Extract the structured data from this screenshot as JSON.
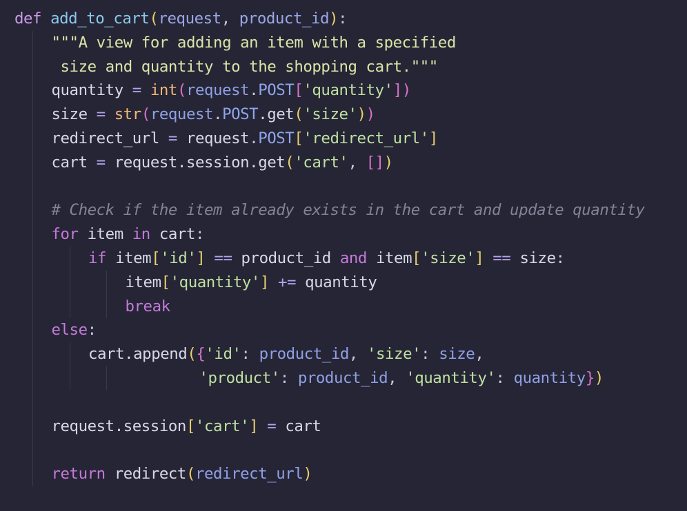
{
  "editor": {
    "language": "python",
    "theme": {
      "background": "#262535",
      "keyword": "#c99be8",
      "function": "#89c8ef",
      "string": "#bfe0a2",
      "comment": "#838398",
      "builtin": "#f0b877"
    },
    "lines": [
      {
        "indent": 0,
        "tokens": [
          {
            "t": "def",
            "c": "kw-def"
          },
          {
            "t": " ",
            "c": "var"
          },
          {
            "t": "add_to_cart",
            "c": "fn-name"
          },
          {
            "t": "(",
            "c": "paren"
          },
          {
            "t": "request",
            "c": "param"
          },
          {
            "t": ", ",
            "c": "punct"
          },
          {
            "t": "product_id",
            "c": "param"
          },
          {
            "t": ")",
            "c": "paren"
          },
          {
            "t": ":",
            "c": "punct"
          }
        ]
      },
      {
        "indent": 1,
        "tokens": [
          {
            "t": "\"\"\"A view for adding an item with a specified",
            "c": "docstr"
          }
        ]
      },
      {
        "indent": 1,
        "tokens": [
          {
            "t": " size and quantity to the shopping cart.\"\"\"",
            "c": "docstr"
          }
        ]
      },
      {
        "indent": 1,
        "tokens": [
          {
            "t": "quantity",
            "c": "var"
          },
          {
            "t": " = ",
            "c": "op"
          },
          {
            "t": "int",
            "c": "builtin"
          },
          {
            "t": "(",
            "c": "bracket"
          },
          {
            "t": "request",
            "c": "ident-param"
          },
          {
            "t": ".",
            "c": "punct"
          },
          {
            "t": "POST",
            "c": "attr"
          },
          {
            "t": "[",
            "c": "bracket"
          },
          {
            "t": "'quantity'",
            "c": "str"
          },
          {
            "t": "]",
            "c": "bracket"
          },
          {
            "t": ")",
            "c": "bracket"
          }
        ]
      },
      {
        "indent": 1,
        "tokens": [
          {
            "t": "size",
            "c": "var"
          },
          {
            "t": " = ",
            "c": "op"
          },
          {
            "t": "str",
            "c": "builtin"
          },
          {
            "t": "(",
            "c": "bracket"
          },
          {
            "t": "request",
            "c": "ident-param"
          },
          {
            "t": ".",
            "c": "punct"
          },
          {
            "t": "POST",
            "c": "attr"
          },
          {
            "t": ".get",
            "c": "var"
          },
          {
            "t": "(",
            "c": "paren"
          },
          {
            "t": "'size'",
            "c": "str"
          },
          {
            "t": ")",
            "c": "paren"
          },
          {
            "t": ")",
            "c": "bracket"
          }
        ]
      },
      {
        "indent": 1,
        "tokens": [
          {
            "t": "redirect_url",
            "c": "var"
          },
          {
            "t": " = ",
            "c": "op"
          },
          {
            "t": "request",
            "c": "var"
          },
          {
            "t": ".",
            "c": "punct"
          },
          {
            "t": "POST",
            "c": "attr"
          },
          {
            "t": "[",
            "c": "paren"
          },
          {
            "t": "'redirect_url'",
            "c": "str"
          },
          {
            "t": "]",
            "c": "paren"
          }
        ]
      },
      {
        "indent": 1,
        "tokens": [
          {
            "t": "cart",
            "c": "var"
          },
          {
            "t": " = ",
            "c": "op"
          },
          {
            "t": "request.session.get",
            "c": "var"
          },
          {
            "t": "(",
            "c": "paren"
          },
          {
            "t": "'cart'",
            "c": "str"
          },
          {
            "t": ", ",
            "c": "punct"
          },
          {
            "t": "[]",
            "c": "bracket"
          },
          {
            "t": ")",
            "c": "paren"
          }
        ]
      },
      {
        "indent": 1,
        "tokens": []
      },
      {
        "indent": 1,
        "tokens": [
          {
            "t": "# Check if the item already exists in the cart and update quantity",
            "c": "comment"
          }
        ]
      },
      {
        "indent": 1,
        "tokens": [
          {
            "t": "for",
            "c": "kw-ctrl"
          },
          {
            "t": " item ",
            "c": "var"
          },
          {
            "t": "in",
            "c": "kw-ctrl"
          },
          {
            "t": " cart",
            "c": "var"
          },
          {
            "t": ":",
            "c": "punct"
          }
        ]
      },
      {
        "indent": 2,
        "tokens": [
          {
            "t": "if",
            "c": "kw-ctrl"
          },
          {
            "t": " item",
            "c": "var"
          },
          {
            "t": "[",
            "c": "paren"
          },
          {
            "t": "'id'",
            "c": "str"
          },
          {
            "t": "]",
            "c": "paren"
          },
          {
            "t": " == ",
            "c": "op"
          },
          {
            "t": "product_id ",
            "c": "var"
          },
          {
            "t": "and",
            "c": "kw-ctrl"
          },
          {
            "t": " item",
            "c": "var"
          },
          {
            "t": "[",
            "c": "paren"
          },
          {
            "t": "'size'",
            "c": "str"
          },
          {
            "t": "]",
            "c": "paren"
          },
          {
            "t": " == ",
            "c": "op"
          },
          {
            "t": "size",
            "c": "var"
          },
          {
            "t": ":",
            "c": "punct"
          }
        ]
      },
      {
        "indent": 3,
        "tokens": [
          {
            "t": "item",
            "c": "var"
          },
          {
            "t": "[",
            "c": "paren"
          },
          {
            "t": "'quantity'",
            "c": "str"
          },
          {
            "t": "]",
            "c": "paren"
          },
          {
            "t": " += ",
            "c": "op"
          },
          {
            "t": "quantity",
            "c": "var"
          }
        ]
      },
      {
        "indent": 3,
        "tokens": [
          {
            "t": "break",
            "c": "kw-ctrl"
          }
        ]
      },
      {
        "indent": 1,
        "tokens": [
          {
            "t": "else",
            "c": "kw-ctrl"
          },
          {
            "t": ":",
            "c": "punct"
          }
        ]
      },
      {
        "indent": 2,
        "tokens": [
          {
            "t": "cart.append",
            "c": "var"
          },
          {
            "t": "(",
            "c": "paren"
          },
          {
            "t": "{",
            "c": "bracket"
          },
          {
            "t": "'id'",
            "c": "str"
          },
          {
            "t": ": ",
            "c": "punct"
          },
          {
            "t": "product_id",
            "c": "ident-param"
          },
          {
            "t": ", ",
            "c": "punct"
          },
          {
            "t": "'size'",
            "c": "str"
          },
          {
            "t": ": ",
            "c": "punct"
          },
          {
            "t": "size",
            "c": "ident-param"
          },
          {
            "t": ",",
            "c": "punct"
          }
        ]
      },
      {
        "indent": 5,
        "tokens": [
          {
            "t": "'product'",
            "c": "str"
          },
          {
            "t": ": ",
            "c": "punct"
          },
          {
            "t": "product_id",
            "c": "ident-param"
          },
          {
            "t": ", ",
            "c": "punct"
          },
          {
            "t": "'quantity'",
            "c": "str"
          },
          {
            "t": ": ",
            "c": "punct"
          },
          {
            "t": "quantity",
            "c": "ident-param"
          },
          {
            "t": "}",
            "c": "bracket"
          },
          {
            "t": ")",
            "c": "paren"
          }
        ]
      },
      {
        "indent": 1,
        "tokens": []
      },
      {
        "indent": 1,
        "tokens": [
          {
            "t": "request.session",
            "c": "var"
          },
          {
            "t": "[",
            "c": "paren"
          },
          {
            "t": "'cart'",
            "c": "str"
          },
          {
            "t": "]",
            "c": "paren"
          },
          {
            "t": " = ",
            "c": "op"
          },
          {
            "t": "cart",
            "c": "var"
          }
        ]
      },
      {
        "indent": 1,
        "tokens": []
      },
      {
        "indent": 1,
        "tokens": [
          {
            "t": "return",
            "c": "kw-ctrl"
          },
          {
            "t": " redirect",
            "c": "var"
          },
          {
            "t": "(",
            "c": "paren"
          },
          {
            "t": "redirect_url",
            "c": "ident-param"
          },
          {
            "t": ")",
            "c": "paren"
          }
        ]
      }
    ]
  }
}
